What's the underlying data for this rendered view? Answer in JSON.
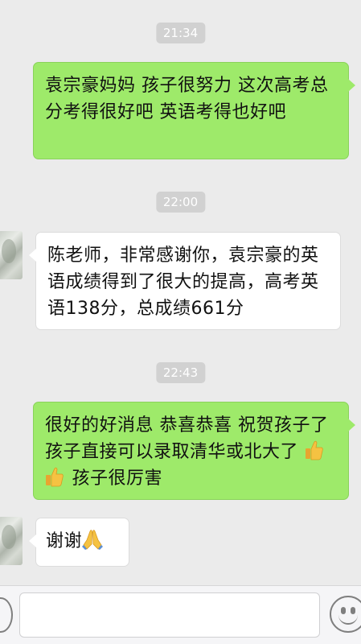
{
  "colors": {
    "background": "#ebebeb",
    "outgoing_bubble": "#9eea6a",
    "incoming_bubble": "#ffffff",
    "time_badge": "#d1d1d1"
  },
  "messages": [
    {
      "type": "time",
      "text": "21:34"
    },
    {
      "type": "outgoing",
      "text": "袁宗豪妈妈  孩子很努力 这次高考总分考得很好吧  英语考得也好吧"
    },
    {
      "type": "time",
      "text": "22:00"
    },
    {
      "type": "incoming",
      "text": "陈老师，非常感谢你，袁宗豪的英语成绩得到了很大的提高，高考英语138分，总成绩661分"
    },
    {
      "type": "time",
      "text": "22:43"
    },
    {
      "type": "outgoing",
      "text_before": "很好的好消息 恭喜恭喜 祝贺孩子了   孩子直接可以录取清华或北大了 ",
      "text_after": " 孩子很厉害",
      "icons": [
        "thumbs-up-icon",
        "thumbs-up-icon"
      ]
    },
    {
      "type": "incoming",
      "text": "谢谢",
      "icon": "praying-hands-icon"
    }
  ],
  "input_bar": {
    "placeholder": "",
    "icons": [
      "voice-toggle-icon",
      "emoji-icon"
    ]
  }
}
